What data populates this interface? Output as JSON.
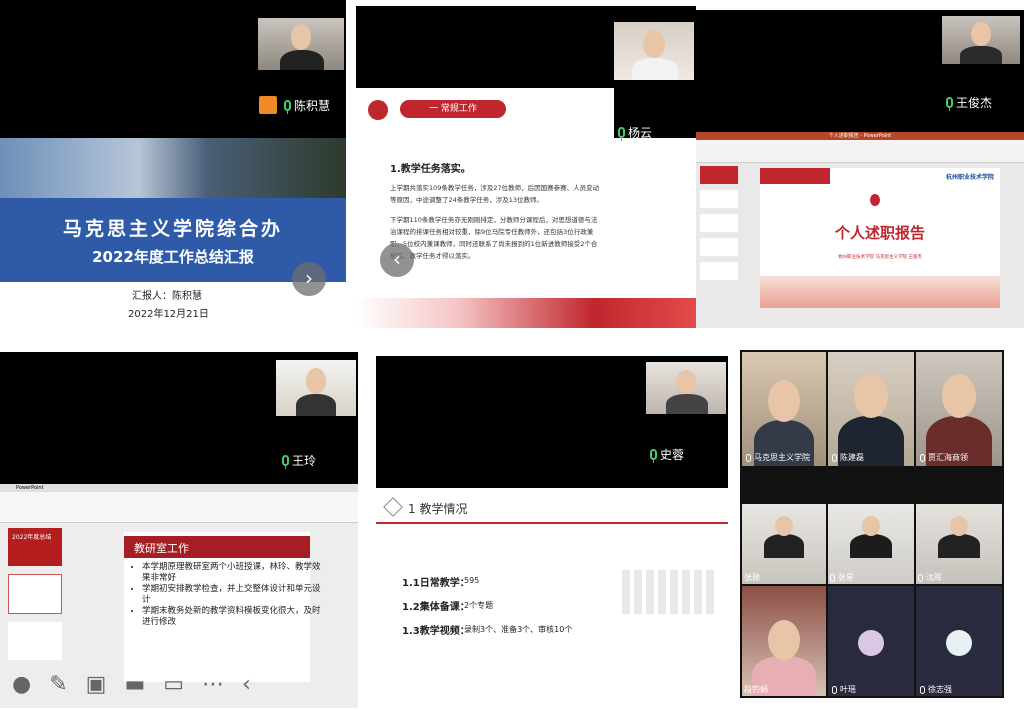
{
  "panel1": {
    "participant": "陈积慧",
    "slide_title": "马克思主义学院综合办",
    "slide_subtitle": "2022年度工作总结汇报",
    "reporter": "汇报人：陈积慧",
    "date": "2022年12月21日"
  },
  "panel2": {
    "participant": "杨云",
    "section_label": "一  常规工作",
    "heading": "1.教学任务落实。",
    "para1": "上学期共落实109条教学任务，涉及27位教师，后因国赛参赛、人员变动等原因，中途调整了24条教学任务，涉及13位教师。",
    "para2": "下学期110条教学任务亦无刚刚排定，分教师分课程后，对思想道德与法治课程的排课任务相对较重，除9位马院专任教师外，还包括3位行政兼职、5位校内兼课教师，同时还联系了尚未报到的1位新进教师接受2个合班后，教学任务才得以落实。"
  },
  "panel3": {
    "participant": "王俊杰",
    "app_title": "个人述职报告 - PowerPoint",
    "school": "杭州职业技术学院",
    "slide_title": "个人述职报告",
    "slide_footer": "杭州职业技术学院 马克思主义学院 王俊杰"
  },
  "panel4": {
    "participant": "王玲",
    "app_name": "PowerPoint",
    "thumb_label": "2022年度总结",
    "card_title": "教研室工作",
    "bullets": [
      "本学期原理教研室两个小班授课，林玲、教学效果非常好",
      "学期初安排教学检查，并上交整体设计和单元设计",
      "学期末教务处新的教学资料模板变化很大，及时进行修改"
    ]
  },
  "panel5": {
    "participant": "史蓉",
    "section": "1 教学情况",
    "items": [
      {
        "label": "1.1日常教学：",
        "value": "595"
      },
      {
        "label": "1.2集体备课：",
        "value": "2个专题"
      },
      {
        "label": "1.3教学视频：",
        "value": "录制3个、准备3个、审核10个"
      }
    ]
  },
  "panel6": {
    "tiles": [
      "马克思主义学院",
      "陈建磊",
      "贾汇海商领",
      "张驰",
      "张星",
      "沈晖",
      "段钓娟",
      "叶瑶",
      "徐志强"
    ]
  },
  "colors": {
    "accent_blue": "#2e5aa8",
    "red": "#c0262d",
    "mic_green": "#3bd16f"
  }
}
